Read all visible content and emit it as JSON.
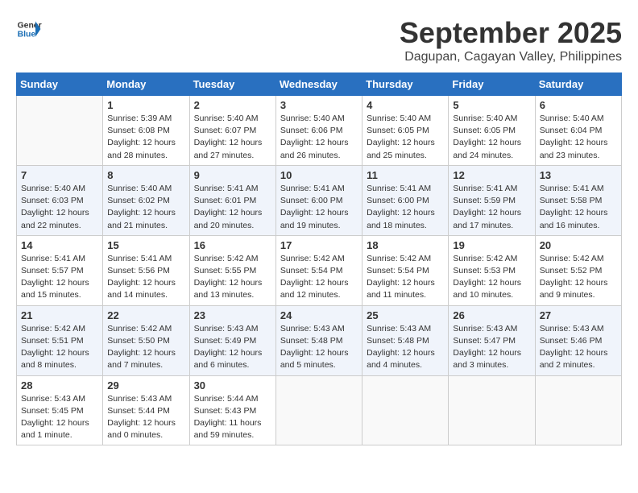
{
  "header": {
    "logo_general": "General",
    "logo_blue": "Blue",
    "month_title": "September 2025",
    "location": "Dagupan, Cagayan Valley, Philippines"
  },
  "weekdays": [
    "Sunday",
    "Monday",
    "Tuesday",
    "Wednesday",
    "Thursday",
    "Friday",
    "Saturday"
  ],
  "weeks": [
    [
      {
        "day": "",
        "info": ""
      },
      {
        "day": "1",
        "info": "Sunrise: 5:39 AM\nSunset: 6:08 PM\nDaylight: 12 hours\nand 28 minutes."
      },
      {
        "day": "2",
        "info": "Sunrise: 5:40 AM\nSunset: 6:07 PM\nDaylight: 12 hours\nand 27 minutes."
      },
      {
        "day": "3",
        "info": "Sunrise: 5:40 AM\nSunset: 6:06 PM\nDaylight: 12 hours\nand 26 minutes."
      },
      {
        "day": "4",
        "info": "Sunrise: 5:40 AM\nSunset: 6:05 PM\nDaylight: 12 hours\nand 25 minutes."
      },
      {
        "day": "5",
        "info": "Sunrise: 5:40 AM\nSunset: 6:05 PM\nDaylight: 12 hours\nand 24 minutes."
      },
      {
        "day": "6",
        "info": "Sunrise: 5:40 AM\nSunset: 6:04 PM\nDaylight: 12 hours\nand 23 minutes."
      }
    ],
    [
      {
        "day": "7",
        "info": "Sunrise: 5:40 AM\nSunset: 6:03 PM\nDaylight: 12 hours\nand 22 minutes."
      },
      {
        "day": "8",
        "info": "Sunrise: 5:40 AM\nSunset: 6:02 PM\nDaylight: 12 hours\nand 21 minutes."
      },
      {
        "day": "9",
        "info": "Sunrise: 5:41 AM\nSunset: 6:01 PM\nDaylight: 12 hours\nand 20 minutes."
      },
      {
        "day": "10",
        "info": "Sunrise: 5:41 AM\nSunset: 6:00 PM\nDaylight: 12 hours\nand 19 minutes."
      },
      {
        "day": "11",
        "info": "Sunrise: 5:41 AM\nSunset: 6:00 PM\nDaylight: 12 hours\nand 18 minutes."
      },
      {
        "day": "12",
        "info": "Sunrise: 5:41 AM\nSunset: 5:59 PM\nDaylight: 12 hours\nand 17 minutes."
      },
      {
        "day": "13",
        "info": "Sunrise: 5:41 AM\nSunset: 5:58 PM\nDaylight: 12 hours\nand 16 minutes."
      }
    ],
    [
      {
        "day": "14",
        "info": "Sunrise: 5:41 AM\nSunset: 5:57 PM\nDaylight: 12 hours\nand 15 minutes."
      },
      {
        "day": "15",
        "info": "Sunrise: 5:41 AM\nSunset: 5:56 PM\nDaylight: 12 hours\nand 14 minutes."
      },
      {
        "day": "16",
        "info": "Sunrise: 5:42 AM\nSunset: 5:55 PM\nDaylight: 12 hours\nand 13 minutes."
      },
      {
        "day": "17",
        "info": "Sunrise: 5:42 AM\nSunset: 5:54 PM\nDaylight: 12 hours\nand 12 minutes."
      },
      {
        "day": "18",
        "info": "Sunrise: 5:42 AM\nSunset: 5:54 PM\nDaylight: 12 hours\nand 11 minutes."
      },
      {
        "day": "19",
        "info": "Sunrise: 5:42 AM\nSunset: 5:53 PM\nDaylight: 12 hours\nand 10 minutes."
      },
      {
        "day": "20",
        "info": "Sunrise: 5:42 AM\nSunset: 5:52 PM\nDaylight: 12 hours\nand 9 minutes."
      }
    ],
    [
      {
        "day": "21",
        "info": "Sunrise: 5:42 AM\nSunset: 5:51 PM\nDaylight: 12 hours\nand 8 minutes."
      },
      {
        "day": "22",
        "info": "Sunrise: 5:42 AM\nSunset: 5:50 PM\nDaylight: 12 hours\nand 7 minutes."
      },
      {
        "day": "23",
        "info": "Sunrise: 5:43 AM\nSunset: 5:49 PM\nDaylight: 12 hours\nand 6 minutes."
      },
      {
        "day": "24",
        "info": "Sunrise: 5:43 AM\nSunset: 5:48 PM\nDaylight: 12 hours\nand 5 minutes."
      },
      {
        "day": "25",
        "info": "Sunrise: 5:43 AM\nSunset: 5:48 PM\nDaylight: 12 hours\nand 4 minutes."
      },
      {
        "day": "26",
        "info": "Sunrise: 5:43 AM\nSunset: 5:47 PM\nDaylight: 12 hours\nand 3 minutes."
      },
      {
        "day": "27",
        "info": "Sunrise: 5:43 AM\nSunset: 5:46 PM\nDaylight: 12 hours\nand 2 minutes."
      }
    ],
    [
      {
        "day": "28",
        "info": "Sunrise: 5:43 AM\nSunset: 5:45 PM\nDaylight: 12 hours\nand 1 minute."
      },
      {
        "day": "29",
        "info": "Sunrise: 5:43 AM\nSunset: 5:44 PM\nDaylight: 12 hours\nand 0 minutes."
      },
      {
        "day": "30",
        "info": "Sunrise: 5:44 AM\nSunset: 5:43 PM\nDaylight: 11 hours\nand 59 minutes."
      },
      {
        "day": "",
        "info": ""
      },
      {
        "day": "",
        "info": ""
      },
      {
        "day": "",
        "info": ""
      },
      {
        "day": "",
        "info": ""
      }
    ]
  ]
}
